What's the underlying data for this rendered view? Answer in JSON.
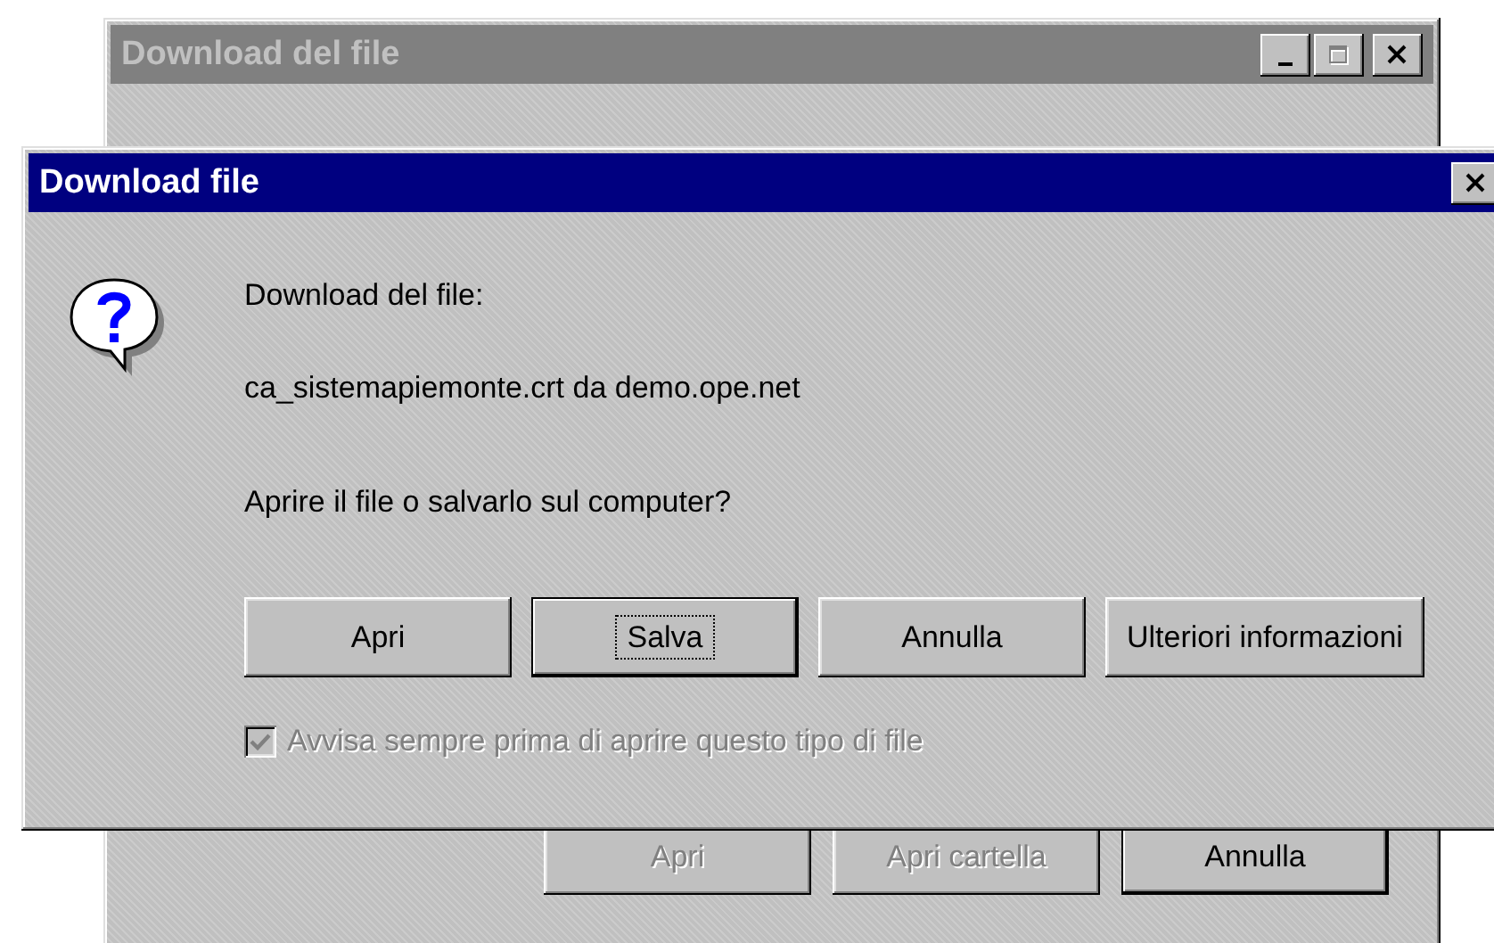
{
  "background_window": {
    "title": "Download del file",
    "active": false,
    "controls": [
      {
        "kind": "minimize",
        "disabled": false
      },
      {
        "kind": "maximize",
        "disabled": true
      },
      {
        "kind": "close",
        "disabled": false
      }
    ],
    "buttons": [
      {
        "label": "Apri",
        "disabled": true,
        "default": false
      },
      {
        "label": "Apri cartella",
        "disabled": true,
        "default": false
      },
      {
        "label": "Annulla",
        "disabled": false,
        "default": true
      }
    ]
  },
  "dialog": {
    "title": "Download file",
    "active": true,
    "controls": [
      {
        "kind": "close",
        "disabled": false
      }
    ],
    "lines": [
      "Download del file:",
      "ca_sistemapiemonte.crt da demo.ope.net"
    ],
    "question": "Aprire il file o salvarlo sul computer?",
    "buttons": [
      {
        "label": "Apri",
        "default": false,
        "focused": false
      },
      {
        "label": "Salva",
        "default": true,
        "focused": true
      },
      {
        "label": "Annulla",
        "default": false,
        "focused": false
      },
      {
        "label": "Ulteriori informazioni",
        "default": false,
        "focused": false
      }
    ],
    "checkbox": {
      "label": "Avvisa sempre prima di aprire questo tipo di file",
      "checked": true,
      "disabled": true
    }
  }
}
